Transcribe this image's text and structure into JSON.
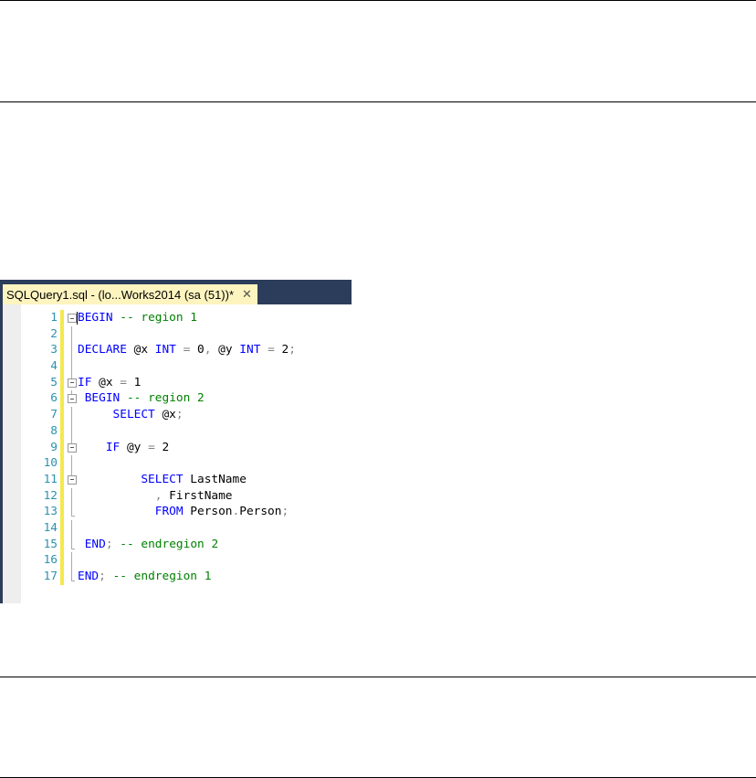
{
  "tab": {
    "title": "SQLQuery1.sql - (lo...Works2014 (sa (51))*",
    "close": "✕"
  },
  "colors": {
    "keyword": "#0000ff",
    "comment": "#008000",
    "operator": "#808080",
    "line_number": "#2b91af",
    "change_bar": "#f5e84a"
  },
  "lines": [
    {
      "n": "1",
      "fold": "box",
      "tokens": [
        [
          "kw",
          "BEGIN"
        ],
        [
          "id",
          " "
        ],
        [
          "cm",
          "-- region 1"
        ]
      ]
    },
    {
      "n": "2",
      "fold": "vl",
      "tokens": []
    },
    {
      "n": "3",
      "fold": "vl",
      "tokens": [
        [
          "kw",
          "DECLARE"
        ],
        [
          "id",
          " @x "
        ],
        [
          "kw",
          "INT"
        ],
        [
          "op",
          " = "
        ],
        [
          "id",
          "0"
        ],
        [
          "op",
          ", "
        ],
        [
          "id",
          "@y "
        ],
        [
          "kw",
          "INT"
        ],
        [
          "op",
          " = "
        ],
        [
          "id",
          "2"
        ],
        [
          "op",
          ";"
        ]
      ]
    },
    {
      "n": "4",
      "fold": "vl",
      "tokens": []
    },
    {
      "n": "5",
      "fold": "box",
      "tokens": [
        [
          "kw",
          "IF"
        ],
        [
          "id",
          " @x "
        ],
        [
          "op",
          "= "
        ],
        [
          "id",
          "1"
        ]
      ]
    },
    {
      "n": "6",
      "fold": "box",
      "tokens": [
        [
          "id",
          " "
        ],
        [
          "kw",
          "BEGIN"
        ],
        [
          "id",
          " "
        ],
        [
          "cm",
          "-- region 2"
        ]
      ]
    },
    {
      "n": "7",
      "fold": "vl",
      "tokens": [
        [
          "id",
          "     "
        ],
        [
          "kw",
          "SELECT"
        ],
        [
          "id",
          " @x"
        ],
        [
          "op",
          ";"
        ]
      ]
    },
    {
      "n": "8",
      "fold": "vl",
      "tokens": []
    },
    {
      "n": "9",
      "fold": "box",
      "tokens": [
        [
          "id",
          "    "
        ],
        [
          "kw",
          "IF"
        ],
        [
          "id",
          " @y "
        ],
        [
          "op",
          "= "
        ],
        [
          "id",
          "2"
        ]
      ]
    },
    {
      "n": "10",
      "fold": "vl",
      "tokens": []
    },
    {
      "n": "11",
      "fold": "box",
      "tokens": [
        [
          "id",
          "         "
        ],
        [
          "kw",
          "SELECT"
        ],
        [
          "id",
          " LastName"
        ]
      ]
    },
    {
      "n": "12",
      "fold": "vl",
      "tokens": [
        [
          "id",
          "           "
        ],
        [
          "op",
          ", "
        ],
        [
          "id",
          "FirstName"
        ]
      ]
    },
    {
      "n": "13",
      "fold": "end",
      "tokens": [
        [
          "id",
          "           "
        ],
        [
          "kw",
          "FROM"
        ],
        [
          "id",
          " Person"
        ],
        [
          "op",
          "."
        ],
        [
          "id",
          "Person"
        ],
        [
          "op",
          ";"
        ]
      ]
    },
    {
      "n": "14",
      "fold": "vl",
      "tokens": []
    },
    {
      "n": "15",
      "fold": "end",
      "tokens": [
        [
          "id",
          " "
        ],
        [
          "kw",
          "END"
        ],
        [
          "op",
          ";"
        ],
        [
          "id",
          " "
        ],
        [
          "cm",
          "-- endregion 2"
        ]
      ]
    },
    {
      "n": "16",
      "fold": "vl",
      "tokens": []
    },
    {
      "n": "17",
      "fold": "end",
      "tokens": [
        [
          "kw",
          "END"
        ],
        [
          "op",
          ";"
        ],
        [
          "id",
          " "
        ],
        [
          "cm",
          "-- endregion 1"
        ]
      ]
    }
  ]
}
